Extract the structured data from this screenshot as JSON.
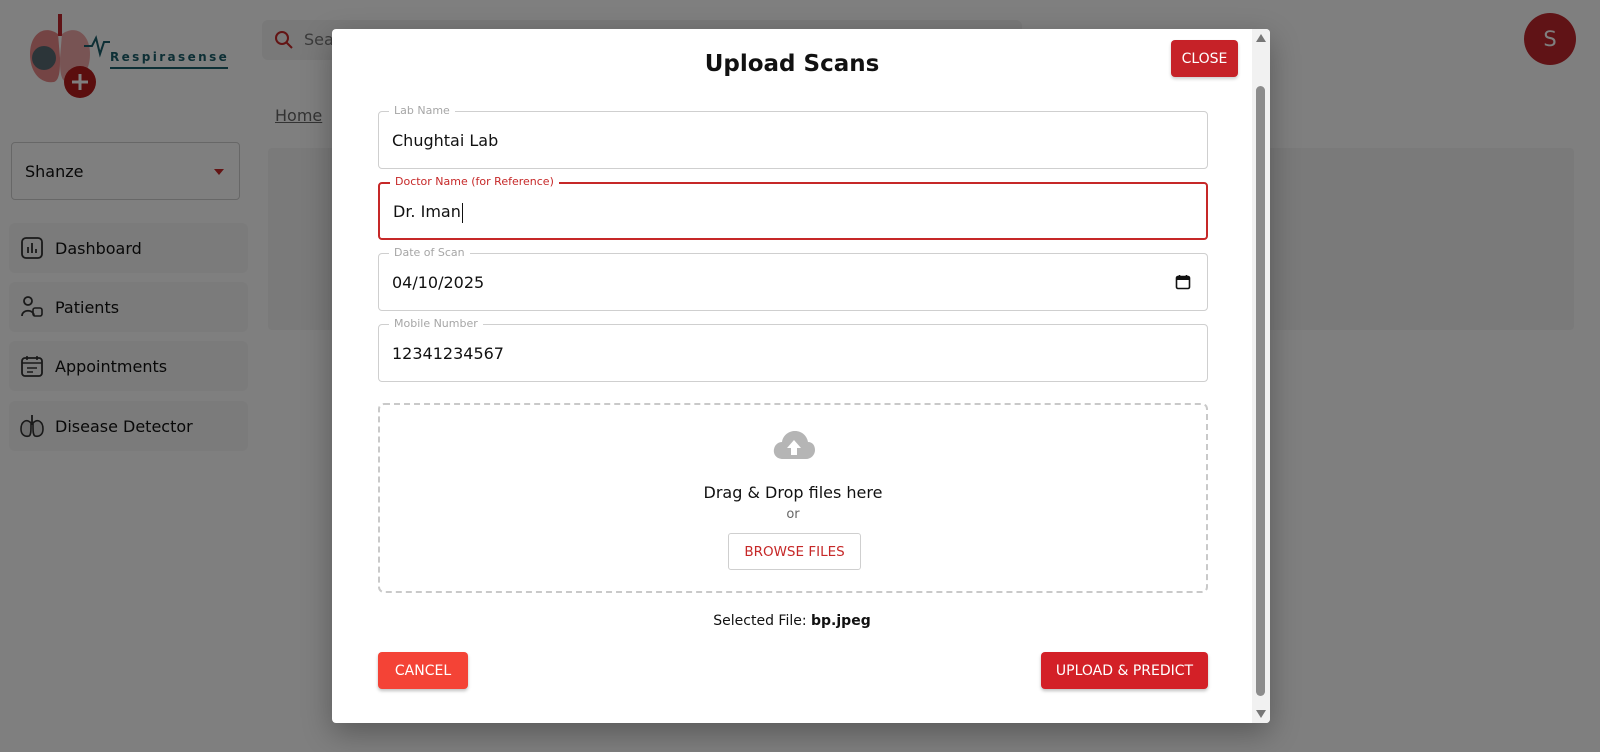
{
  "app": {
    "logo_text": "Respirasense",
    "search_placeholder": "Sea",
    "avatar_initial": "S",
    "breadcrumb": "Home"
  },
  "sidebar": {
    "selected_user": "Shanze",
    "items": [
      {
        "label": "Dashboard",
        "icon": "dashboard-icon"
      },
      {
        "label": "Patients",
        "icon": "patients-icon"
      },
      {
        "label": "Appointments",
        "icon": "appointments-icon"
      },
      {
        "label": "Disease Detector",
        "icon": "lungs-icon"
      }
    ]
  },
  "modal": {
    "title": "Upload Scans",
    "close_label": "CLOSE",
    "fields": [
      {
        "label": "Lab Name",
        "value": "Chughtai Lab"
      },
      {
        "label": "Doctor Name (for Reference)",
        "value": "Dr. Iman"
      },
      {
        "label": "Date of Scan",
        "value": "04/10/2025"
      },
      {
        "label": "Mobile Number",
        "value": "12341234567"
      }
    ],
    "dropzone": {
      "text": "Drag & Drop files here",
      "or": "or",
      "browse_label": "BROWSE FILES"
    },
    "selected_file_label": "Selected File:",
    "selected_file_name": "bp.jpeg",
    "cancel_label": "CANCEL",
    "upload_label": "UPLOAD & PREDICT"
  },
  "colors": {
    "accent": "#c62828",
    "primary_button": "#d32027",
    "cancel_button": "#f44336",
    "brand_teal": "#1b5e6b"
  }
}
